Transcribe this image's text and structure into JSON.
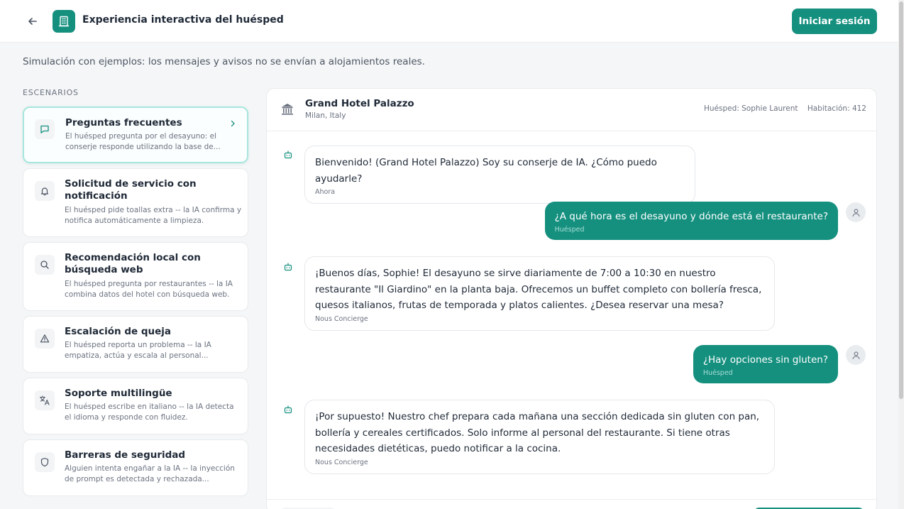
{
  "header": {
    "title": "Experiencia interactiva del huésped",
    "login_label": "Iniciar sesión",
    "icons": {
      "back": "arrow-left-icon",
      "logo": "building-icon"
    }
  },
  "notice": "Simulación con ejemplos: los mensajes y avisos no se envían a alojamientos reales.",
  "sidebar": {
    "section_label": "ESCENARIOS",
    "items": [
      {
        "title": "Preguntas frecuentes",
        "desc": "El huésped pregunta por el desayuno: el conserje responde utilizando la base de...",
        "icon": "message-square-icon",
        "active": true
      },
      {
        "title": "Solicitud de servicio con notificación",
        "desc": "El huésped pide toallas extra -- la IA confirma y notifica automáticamente a limpieza.",
        "icon": "bell-icon",
        "active": false
      },
      {
        "title": "Recomendación local con búsqueda web",
        "desc": "El huésped pregunta por restaurantes -- la IA combina datos del hotel con búsqueda web.",
        "icon": "search-icon",
        "active": false
      },
      {
        "title": "Escalación de queja",
        "desc": "El huésped reporta un problema -- la IA empatiza, actúa y escala al personal...",
        "icon": "alert-triangle-icon",
        "active": false
      },
      {
        "title": "Soporte multilingüe",
        "desc": "El huésped escribe en italiano -- la IA detecta el idioma y responde con fluidez.",
        "icon": "translate-icon",
        "active": false
      },
      {
        "title": "Barreras de seguridad",
        "desc": "Alguien intenta engañar a la IA -- la inyección de prompt es detectada y rechazada...",
        "icon": "shield-icon",
        "active": false
      }
    ]
  },
  "chat": {
    "hotel_name": "Grand Hotel Palazzo",
    "hotel_location": "Milan, Italy",
    "guest_label": "Huésped: Sophie Laurent",
    "room_label": "Habitación: 412",
    "messages": [
      {
        "role": "bot",
        "text": "Bienvenido! (Grand Hotel Palazzo) Soy su conserje de IA. ¿Cómo puedo ayudarle?",
        "meta": "Ahora"
      },
      {
        "role": "user",
        "text": "¿A qué hora es el desayuno y dónde está el restaurante?",
        "meta": "Huésped"
      },
      {
        "role": "bot",
        "text": "¡Buenos días, Sophie! El desayuno se sirve diariamente de 7:00 a 10:30 en nuestro restaurante \"Il Giardino\" en la planta baja. Ofrecemos un buffet completo con bollería fresca, quesos italianos, frutas de temporada y platos calientes. ¿Desea reservar una mesa?",
        "meta": "Nous Concierge"
      },
      {
        "role": "user",
        "text": "¿Hay opciones sin gluten?",
        "meta": "Huésped"
      },
      {
        "role": "bot",
        "text": "¡Por supuesto! Nuestro chef prepara cada mañana una sección dedicada sin gluten con pan, bollería y cereales certificados. Solo informe al personal del restaurante. Si tiene otras necesidades dietéticas, puedo notificar a la cocina.",
        "meta": "Nous Concierge"
      }
    ]
  },
  "colors": {
    "accent": "#15907f",
    "accent_light": "#a8e6dd"
  }
}
